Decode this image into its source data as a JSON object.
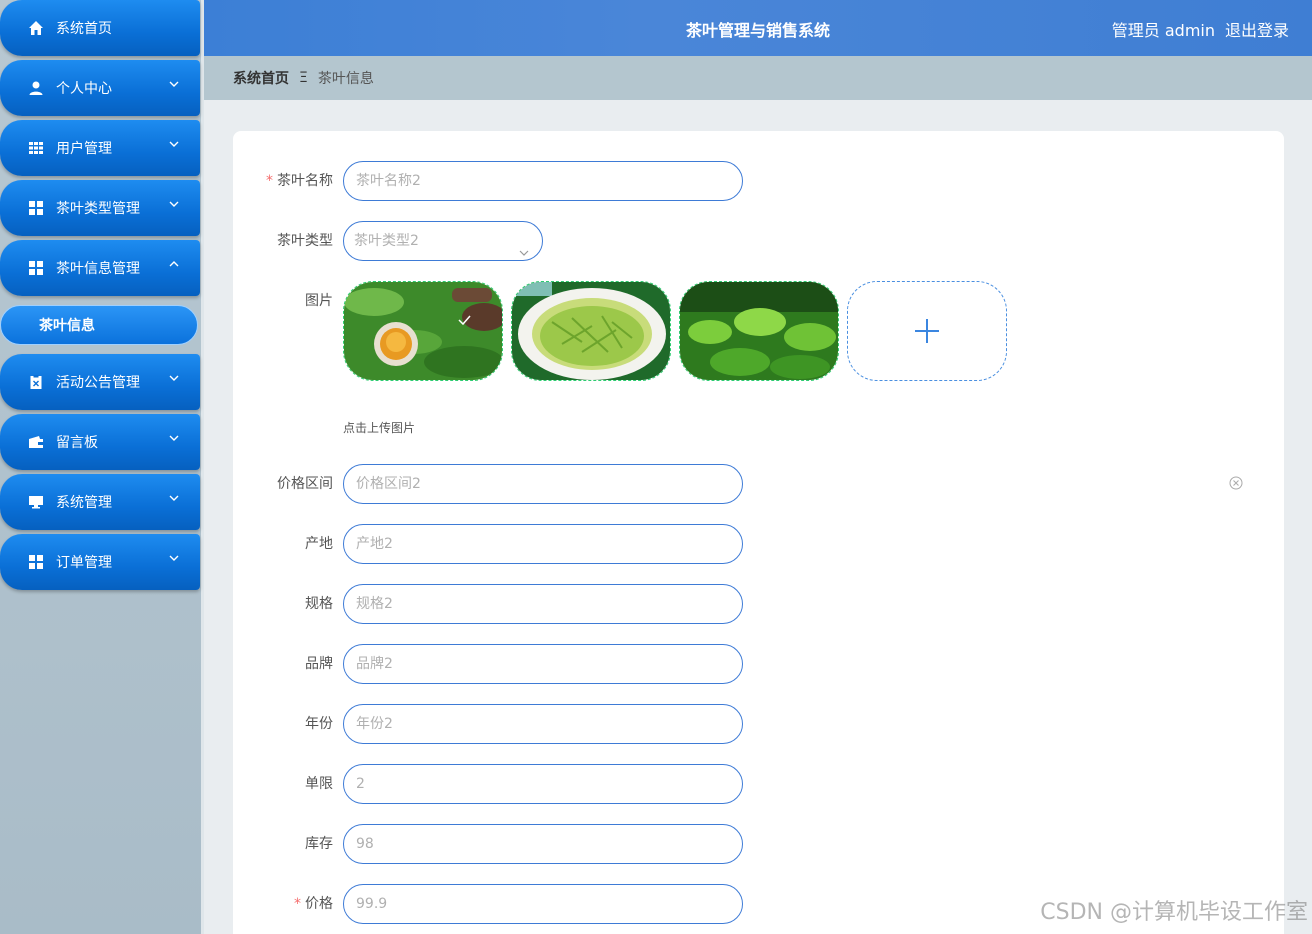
{
  "app": {
    "title": "茶叶管理与销售系统",
    "user": "管理员 admin",
    "logout": "退出登录"
  },
  "sidebar": {
    "items": [
      {
        "label": "系统首页",
        "icon": "home-icon"
      },
      {
        "label": "个人中心",
        "icon": "user-icon"
      },
      {
        "label": "用户管理",
        "icon": "grid-icon"
      },
      {
        "label": "茶叶类型管理",
        "icon": "apps-icon"
      },
      {
        "label": "茶叶信息管理",
        "icon": "apps-icon"
      },
      {
        "label": "活动公告管理",
        "icon": "clipboard-icon"
      },
      {
        "label": "留言板",
        "icon": "wallet-icon"
      },
      {
        "label": "系统管理",
        "icon": "monitor-icon"
      },
      {
        "label": "订单管理",
        "icon": "apps-icon"
      }
    ],
    "active_sub": "茶叶信息"
  },
  "breadcrumb": {
    "home": "系统首页",
    "separator": "Ξ",
    "current": "茶叶信息"
  },
  "form": {
    "name": {
      "label": "茶叶名称",
      "placeholder": "茶叶名称2"
    },
    "type": {
      "label": "茶叶类型",
      "value": "茶叶类型2"
    },
    "image": {
      "label": "图片",
      "hint": "点击上传图片"
    },
    "price_range": {
      "label": "价格区间",
      "placeholder": "价格区间2"
    },
    "origin": {
      "label": "产地",
      "placeholder": "产地2"
    },
    "spec": {
      "label": "规格",
      "placeholder": "规格2"
    },
    "brand": {
      "label": "品牌",
      "placeholder": "品牌2"
    },
    "year": {
      "label": "年份",
      "placeholder": "年份2"
    },
    "limit": {
      "label": "单限",
      "value": "2"
    },
    "stock": {
      "label": "库存",
      "value": "98"
    },
    "price": {
      "label": "价格",
      "value": "99.9"
    }
  },
  "watermark": "CSDN @计算机毕设工作室"
}
